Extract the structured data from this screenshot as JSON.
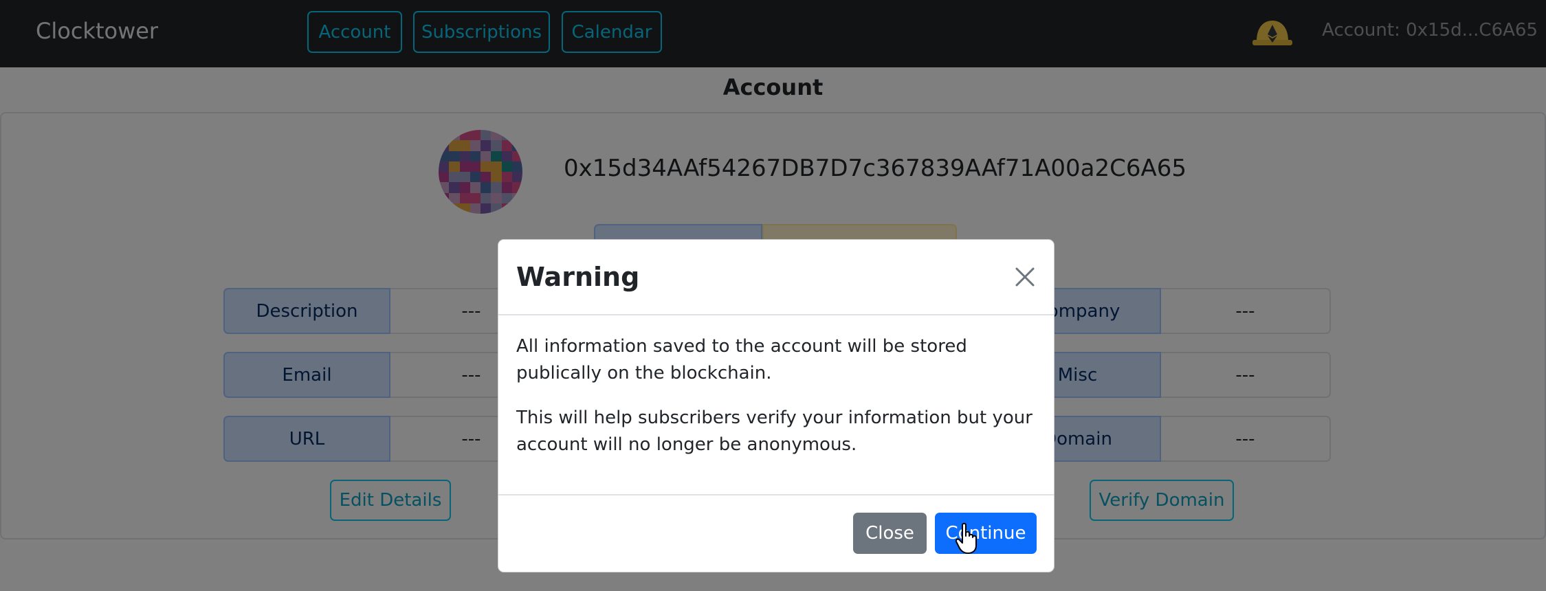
{
  "navbar": {
    "brand": "Clocktower",
    "links": [
      "Account",
      "Subscriptions",
      "Calendar"
    ],
    "account_label": "Account: 0x15d...C6A65",
    "wallet_icon": "metamask-helmet-icon"
  },
  "page": {
    "title": "Account",
    "address": "0x15d34AAf54267DB7D7c367839AAf71A00a2C6A65",
    "fields_left": [
      {
        "label": "Description",
        "value": "---"
      },
      {
        "label": "Email",
        "value": "---"
      },
      {
        "label": "URL",
        "value": "---"
      }
    ],
    "fields_right": [
      {
        "label": "Company",
        "value": "---"
      },
      {
        "label": "Misc",
        "value": "---"
      },
      {
        "label": "Domain",
        "value": "---"
      }
    ],
    "edit_button": "Edit Details",
    "verify_button": "Verify Domain"
  },
  "modal": {
    "title": "Warning",
    "paragraph1": "All information saved to the account will be stored publically on the blockchain.",
    "paragraph2": "This will help subscribers verify your information but your account will no longer be anonymous.",
    "close_button": "Close",
    "continue_button": "Continue"
  },
  "colors": {
    "navbar_bg": "#212529",
    "accent_info": "#0dcaf0",
    "primary": "#0d6efd",
    "secondary": "#6c757d"
  }
}
